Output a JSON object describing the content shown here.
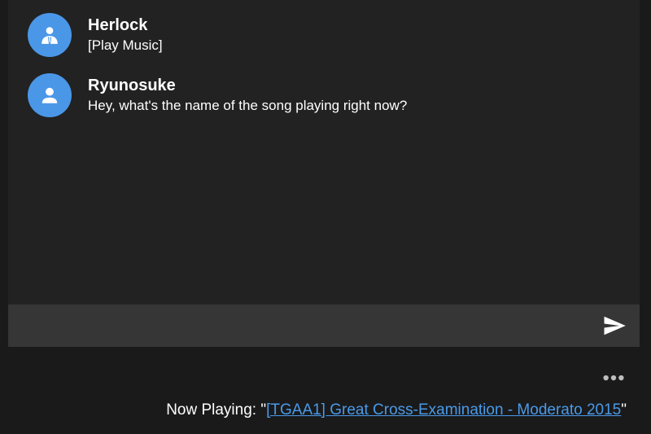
{
  "messages": [
    {
      "author": "Herlock",
      "text": "[Play Music]",
      "avatar_icon": "detective-user-icon"
    },
    {
      "author": "Ryunosuke",
      "text": "Hey, what's the name of the song playing right now?",
      "avatar_icon": "user-icon"
    }
  ],
  "composer": {
    "value": "",
    "send_icon": "send-icon"
  },
  "footer": {
    "more_icon": "more-horizontal-icon",
    "now_playing_label": "Now Playing: ",
    "quote_open": "\"",
    "track_title": "[TGAA1] Great Cross-Examination - Moderato 2015",
    "quote_close": "\""
  },
  "colors": {
    "background": "#1a1a1b",
    "chat_panel": "#222222",
    "input_bar": "#363636",
    "avatar": "#4a97e8",
    "link": "#4a9ae8"
  }
}
